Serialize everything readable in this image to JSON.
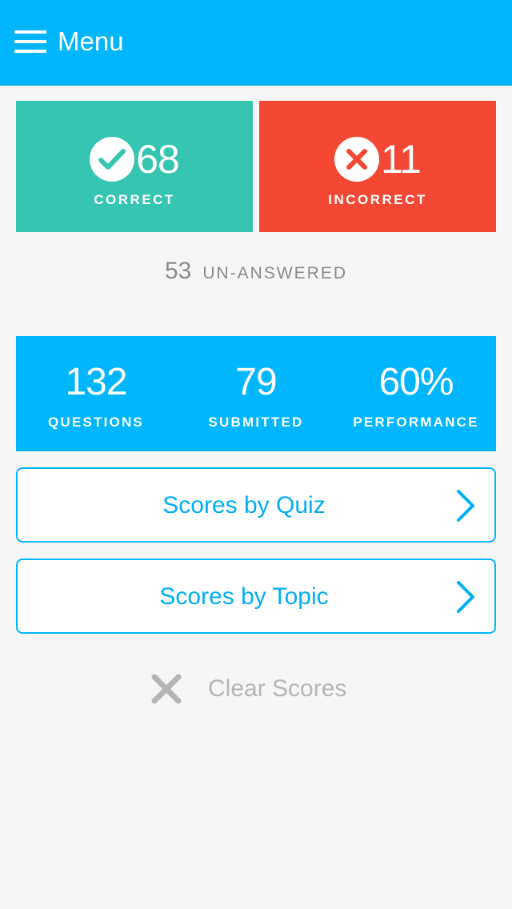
{
  "header": {
    "menu_label": "Menu",
    "icon": "hamburger-menu-icon"
  },
  "scores": {
    "correct": {
      "value": "68",
      "label": "CORRECT",
      "icon": "checkmark-icon",
      "color": "#35c5b0"
    },
    "incorrect": {
      "value": "11",
      "label": "INCORRECT",
      "icon": "x-mark-icon",
      "color": "#f44834"
    }
  },
  "unanswered": {
    "value": "53",
    "label": "UN-ANSWERED"
  },
  "stats": [
    {
      "value": "132",
      "label": "QUESTIONS"
    },
    {
      "value": "79",
      "label": "SUBMITTED"
    },
    {
      "value": "60%",
      "label": "PERFORMANCE"
    }
  ],
  "buttons": {
    "quiz": {
      "label": "Scores by Quiz",
      "icon": "chevron-right-icon"
    },
    "topic": {
      "label": "Scores by Topic",
      "icon": "chevron-right-icon"
    }
  },
  "clear": {
    "label": "Clear Scores",
    "icon": "close-icon"
  },
  "colors": {
    "accent": "#01b6fd",
    "correct": "#35c5b0",
    "incorrect": "#f44834",
    "background": "#f6f6f6"
  }
}
